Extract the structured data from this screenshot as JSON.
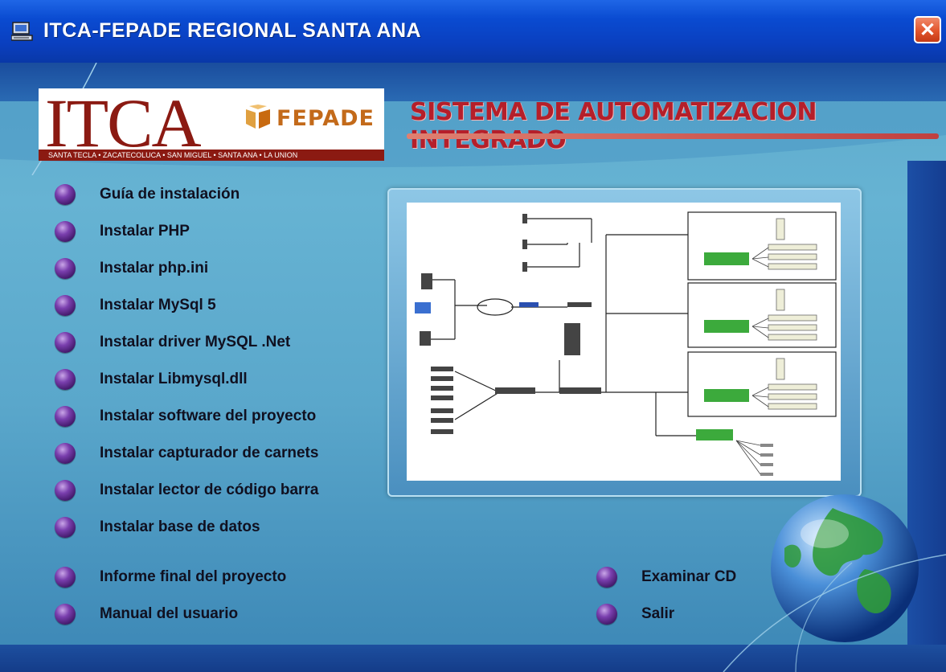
{
  "window": {
    "title": "ITCA-FEPADE REGIONAL SANTA ANA",
    "close_symbol": "✕"
  },
  "logo": {
    "itca": "ITCA",
    "fepade": "FEPADE",
    "strip": "SANTA TECLA • ZACATECOLUCA • SAN MIGUEL • SANTA ANA • LA UNION"
  },
  "header": {
    "system_title": "SISTEMA DE AUTOMATIZACION INTEGRADO"
  },
  "menu": {
    "items": [
      {
        "label": "Guía de instalación"
      },
      {
        "label": "Instalar PHP"
      },
      {
        "label": "Instalar php.ini"
      },
      {
        "label": "Instalar MySql 5"
      },
      {
        "label": "Instalar driver MySQL .Net"
      },
      {
        "label": "Instalar Libmysql.dll"
      },
      {
        "label": "Instalar software del proyecto"
      },
      {
        "label": "Instalar capturador de carnets"
      },
      {
        "label": "Instalar lector de código barra"
      },
      {
        "label": "Instalar base de datos"
      },
      {
        "label": "Informe final del proyecto"
      },
      {
        "label": "Manual del usuario"
      }
    ],
    "right_items": [
      {
        "label": "Examinar CD"
      },
      {
        "label": "Salir"
      }
    ]
  },
  "colors": {
    "title_bar": "#0a4bd1",
    "background": "#5aa6c9",
    "system_title": "#b51f2a",
    "bullet": "#7a3fae",
    "close": "#e2552c"
  },
  "icons": {
    "app": "computer-icon",
    "close": "close-icon",
    "bullet": "bullet-icon",
    "globe": "globe-icon"
  }
}
